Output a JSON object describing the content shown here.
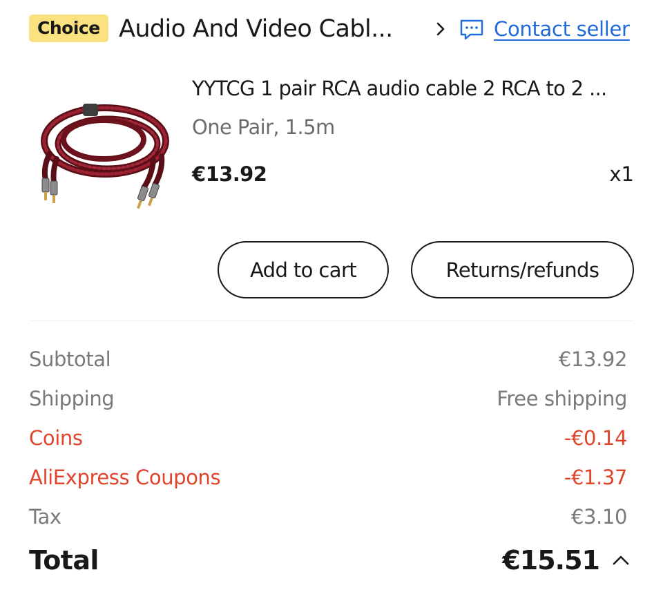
{
  "header": {
    "badge": "Choice",
    "store_title": "Audio And Video Cabl...",
    "contact_seller": "Contact seller"
  },
  "product": {
    "title": "YYTCG 1 pair RCA audio cable 2 RCA to 2 ...",
    "variant": "One Pair, 1.5m",
    "price": "€13.92",
    "quantity": "x1"
  },
  "actions": {
    "add_to_cart": "Add to cart",
    "returns_refunds": "Returns/refunds"
  },
  "summary": {
    "subtotal_label": "Subtotal",
    "subtotal_value": "€13.92",
    "shipping_label": "Shipping",
    "shipping_value": "Free shipping",
    "coins_label": "Coins",
    "coins_value": "-€0.14",
    "coupons_label": "AliExpress Coupons",
    "coupons_value": "-€1.37",
    "tax_label": "Tax",
    "tax_value": "€3.10",
    "total_label": "Total",
    "total_value": "€15.51"
  },
  "icons": {
    "header_arrow": "chevron-right-icon",
    "contact": "chat-icon",
    "total_toggle": "chevron-up-icon"
  },
  "colors": {
    "badge_bg": "#fbe280",
    "link_blue": "#1f6ad9",
    "discount_red": "#e0452c",
    "muted_grey": "#7a7a7a",
    "cable_red": "#7a1420"
  }
}
